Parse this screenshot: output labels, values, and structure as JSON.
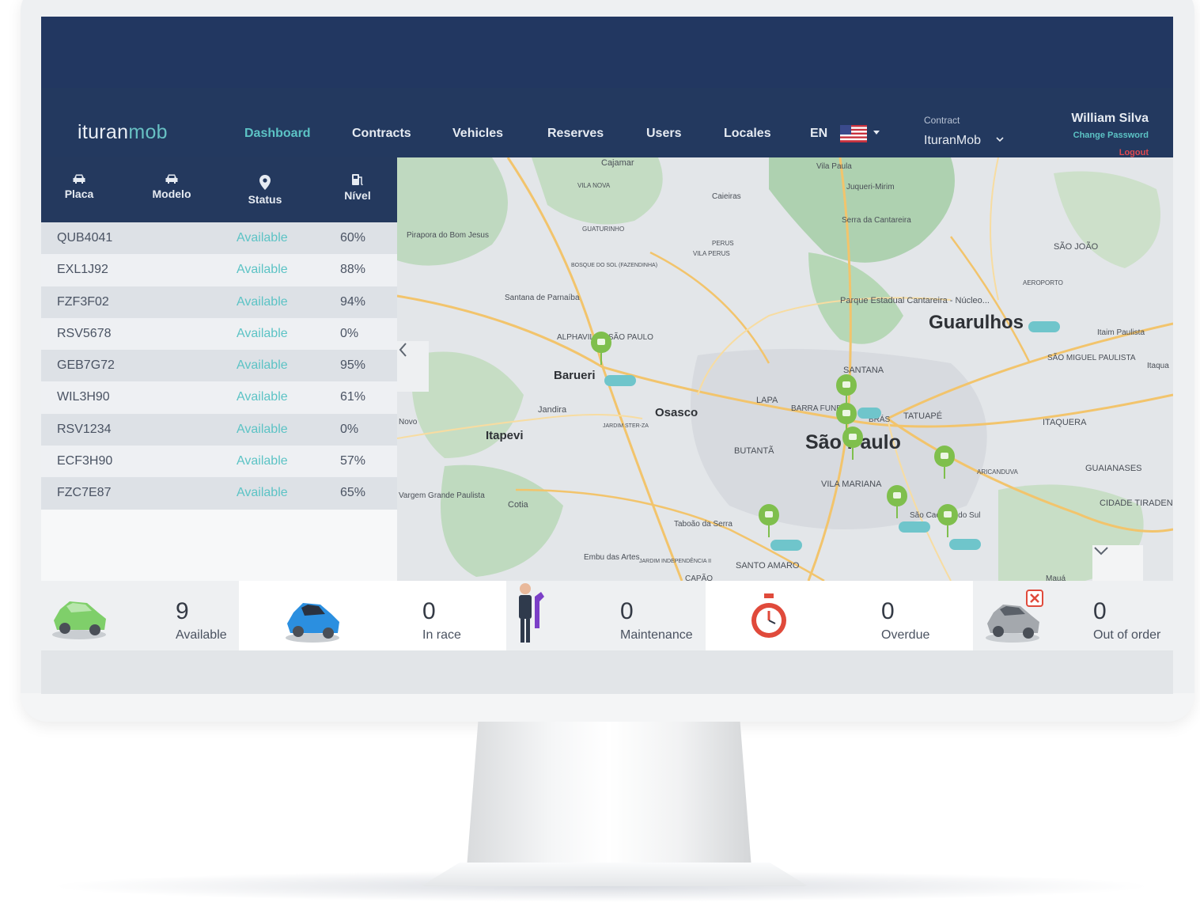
{
  "brand": {
    "part1": "ituran",
    "part2": "mob"
  },
  "nav": {
    "items": [
      {
        "label": "Dashboard",
        "active": true
      },
      {
        "label": "Contracts",
        "active": false
      },
      {
        "label": "Vehicles",
        "active": false
      },
      {
        "label": "Reserves",
        "active": false
      },
      {
        "label": "Users",
        "active": false
      },
      {
        "label": "Locales",
        "active": false
      }
    ],
    "language": "EN"
  },
  "contract": {
    "label": "Contract",
    "value": "IturanMob"
  },
  "user": {
    "name": "William Silva",
    "change_password": "Change Password",
    "logout": "Logout"
  },
  "table": {
    "headers": {
      "plate": "Placa",
      "model": "Modelo",
      "status": "Status",
      "level": "Nível"
    },
    "rows": [
      {
        "plate": "QUB4041",
        "model": "",
        "status": "Available",
        "level": "60%"
      },
      {
        "plate": "EXL1J92",
        "model": "",
        "status": "Available",
        "level": "88%"
      },
      {
        "plate": "FZF3F02",
        "model": "",
        "status": "Available",
        "level": "94%"
      },
      {
        "plate": "RSV5678",
        "model": "",
        "status": "Available",
        "level": "0%"
      },
      {
        "plate": "GEB7G72",
        "model": "",
        "status": "Available",
        "level": "95%"
      },
      {
        "plate": "WIL3H90",
        "model": "",
        "status": "Available",
        "level": "61%"
      },
      {
        "plate": "RSV1234",
        "model": "",
        "status": "Available",
        "level": "0%"
      },
      {
        "plate": "ECF3H90",
        "model": "",
        "status": "Available",
        "level": "57%"
      },
      {
        "plate": "FZC7E87",
        "model": "",
        "status": "Available",
        "level": "65%"
      }
    ]
  },
  "map": {
    "labels_major": [
      "Guarulhos",
      "São Paulo",
      "Barueri",
      "Osasco",
      "Itapevi"
    ],
    "labels_minor": [
      "Cajamar",
      "VILA NOVA",
      "Caieiras",
      "Vila Paula",
      "Juqueri-Mirim",
      "Serra da Cantareira",
      "GUATURINHO",
      "PERUS",
      "VILA PERUS",
      "BOSQUE DO SOL (FAZENDINHA)",
      "Pirapora do Bom Jesus",
      "Santana de Parnaíba",
      "SÃO JOÃO",
      "AEROPORTO",
      "Parque Estadual Cantareira - Núcleo...",
      "Itaim Paulista",
      "SÃO MIGUEL PAULISTA",
      "Itaqua",
      "ALPHAVILLE, SÃO PAULO",
      "SANTANA",
      "Jandira",
      "LAPA",
      "BARRA FUNDA",
      "BRÁS",
      "TATUAPÉ",
      "ITAQUERA",
      "JARDIM STER-ZA",
      "BUTANTÃ",
      "ARICANDUVA",
      "GUAIANASES",
      "VILA MARIANA",
      "CIDADE TIRADENTES",
      "Cotia",
      "Taboão da Serra",
      "São Caetano do Sul",
      "Embu das Artes",
      "JARDIM INDEPENDÊNCIA II",
      "SANTO AMARO",
      "CAPÃO",
      "Novo",
      "Vargem Grande Paulista",
      "Mauá"
    ]
  },
  "stats": [
    {
      "count": "9",
      "label": "Available",
      "icon": "green-car-icon"
    },
    {
      "count": "0",
      "label": "In race",
      "icon": "blue-car-icon"
    },
    {
      "count": "0",
      "label": "Maintenance",
      "icon": "mechanic-icon"
    },
    {
      "count": "0",
      "label": "Overdue",
      "icon": "stopwatch-icon"
    },
    {
      "count": "0",
      "label": "Out of order",
      "icon": "broken-car-icon"
    }
  ],
  "colors": {
    "nav_bg": "#23395f",
    "accent": "#5cc3c5",
    "logout": "#e0494f",
    "pin": "#7fbf4d",
    "car": "#6fc5cb"
  }
}
